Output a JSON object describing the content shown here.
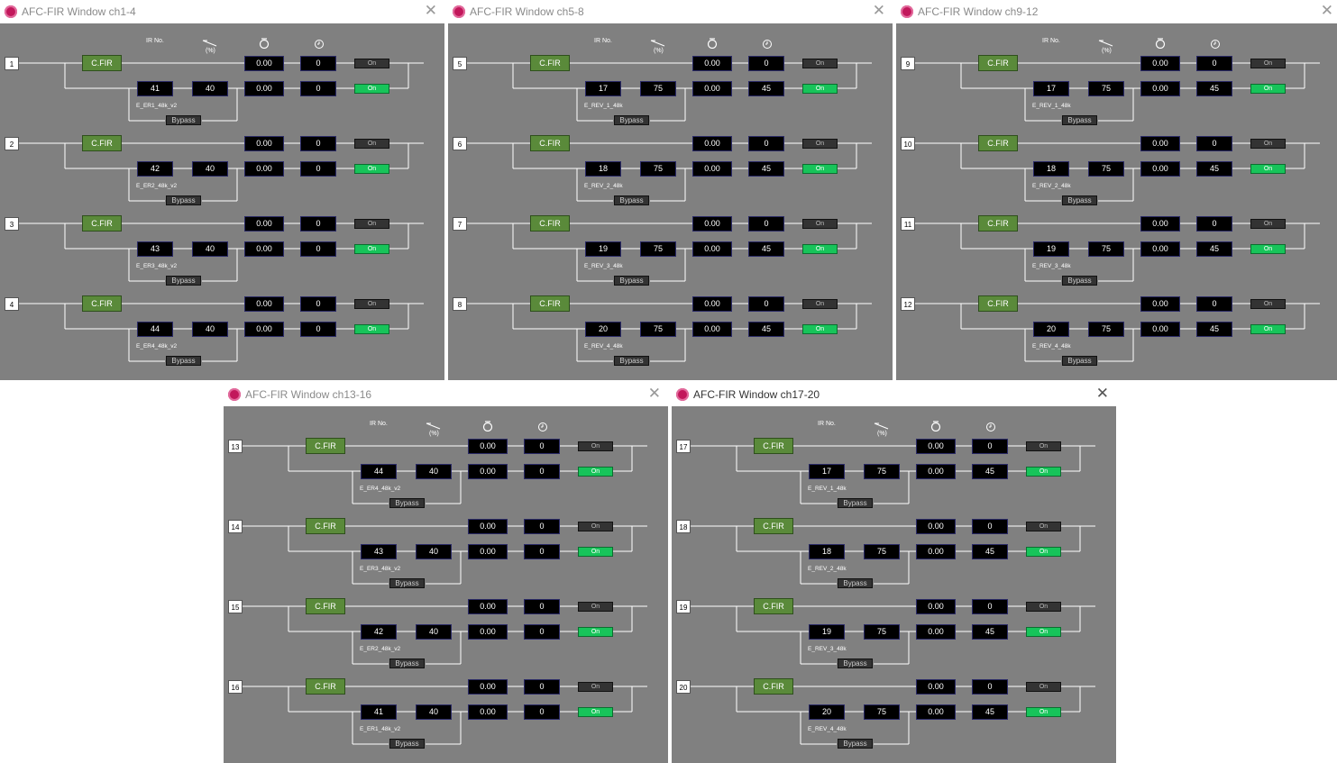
{
  "windows": [
    {
      "title": "AFC-FIR Window ch1-4",
      "active": false,
      "channels": [
        {
          "ch": "1",
          "ir_no": "41",
          "pct": "40",
          "level": "0.00",
          "delay": "0",
          "ir_name": "E_ER1_48k_v2"
        },
        {
          "ch": "2",
          "ir_no": "42",
          "pct": "40",
          "level": "0.00",
          "delay": "0",
          "ir_name": "E_ER2_48k_v2"
        },
        {
          "ch": "3",
          "ir_no": "43",
          "pct": "40",
          "level": "0.00",
          "delay": "0",
          "ir_name": "E_ER3_48k_v2"
        },
        {
          "ch": "4",
          "ir_no": "44",
          "pct": "40",
          "level": "0.00",
          "delay": "0",
          "ir_name": "E_ER4_48k_v2"
        }
      ]
    },
    {
      "title": "AFC-FIR Window ch5-8",
      "active": false,
      "channels": [
        {
          "ch": "5",
          "ir_no": "17",
          "pct": "75",
          "level": "0.00",
          "delay": "45",
          "ir_name": "E_REV_1_48k"
        },
        {
          "ch": "6",
          "ir_no": "18",
          "pct": "75",
          "level": "0.00",
          "delay": "45",
          "ir_name": "E_REV_2_48k"
        },
        {
          "ch": "7",
          "ir_no": "19",
          "pct": "75",
          "level": "0.00",
          "delay": "45",
          "ir_name": "E_REV_3_48k"
        },
        {
          "ch": "8",
          "ir_no": "20",
          "pct": "75",
          "level": "0.00",
          "delay": "45",
          "ir_name": "E_REV_4_48k"
        }
      ]
    },
    {
      "title": "AFC-FIR Window ch9-12",
      "active": false,
      "channels": [
        {
          "ch": "9",
          "ir_no": "17",
          "pct": "75",
          "level": "0.00",
          "delay": "45",
          "ir_name": "E_REV_1_48k"
        },
        {
          "ch": "10",
          "ir_no": "18",
          "pct": "75",
          "level": "0.00",
          "delay": "45",
          "ir_name": "E_REV_2_48k"
        },
        {
          "ch": "11",
          "ir_no": "19",
          "pct": "75",
          "level": "0.00",
          "delay": "45",
          "ir_name": "E_REV_3_48k"
        },
        {
          "ch": "12",
          "ir_no": "20",
          "pct": "75",
          "level": "0.00",
          "delay": "45",
          "ir_name": "E_REV_4_48k"
        }
      ]
    },
    {
      "title": "AFC-FIR Window ch13-16",
      "active": false,
      "channels": [
        {
          "ch": "13",
          "ir_no": "44",
          "pct": "40",
          "level": "0.00",
          "delay": "0",
          "ir_name": "E_ER4_48k_v2"
        },
        {
          "ch": "14",
          "ir_no": "43",
          "pct": "40",
          "level": "0.00",
          "delay": "0",
          "ir_name": "E_ER3_48k_v2"
        },
        {
          "ch": "15",
          "ir_no": "42",
          "pct": "40",
          "level": "0.00",
          "delay": "0",
          "ir_name": "E_ER2_48k_v2"
        },
        {
          "ch": "16",
          "ir_no": "41",
          "pct": "40",
          "level": "0.00",
          "delay": "0",
          "ir_name": "E_ER1_48k_v2"
        }
      ]
    },
    {
      "title": "AFC-FIR Window ch17-20",
      "active": true,
      "channels": [
        {
          "ch": "17",
          "ir_no": "17",
          "pct": "75",
          "level": "0.00",
          "delay": "45",
          "ir_name": "E_REV_1_48k"
        },
        {
          "ch": "18",
          "ir_no": "18",
          "pct": "75",
          "level": "0.00",
          "delay": "45",
          "ir_name": "E_REV_2_48k"
        },
        {
          "ch": "19",
          "ir_no": "19",
          "pct": "75",
          "level": "0.00",
          "delay": "45",
          "ir_name": "E_REV_3_48k"
        },
        {
          "ch": "20",
          "ir_no": "20",
          "pct": "75",
          "level": "0.00",
          "delay": "45",
          "ir_name": "E_REV_4_48k"
        }
      ]
    }
  ],
  "labels": {
    "ir_no": "IR No.",
    "pct": "(%)",
    "cfir": "C.FIR",
    "top_level": "0.00",
    "top_delay": "0",
    "on": "On",
    "bypass": "Bypass",
    "close": "✕",
    "icons": {
      "app": "app-logo-icon",
      "mix": "mix-slope-icon",
      "level": "level-knob-icon",
      "delay": "delay-clock-icon"
    }
  },
  "colors": {
    "panel": "#808080",
    "cfir": "#5a8a3a",
    "on_active": "#17c45a",
    "on_off": "#333333",
    "value_box": "#000000"
  }
}
